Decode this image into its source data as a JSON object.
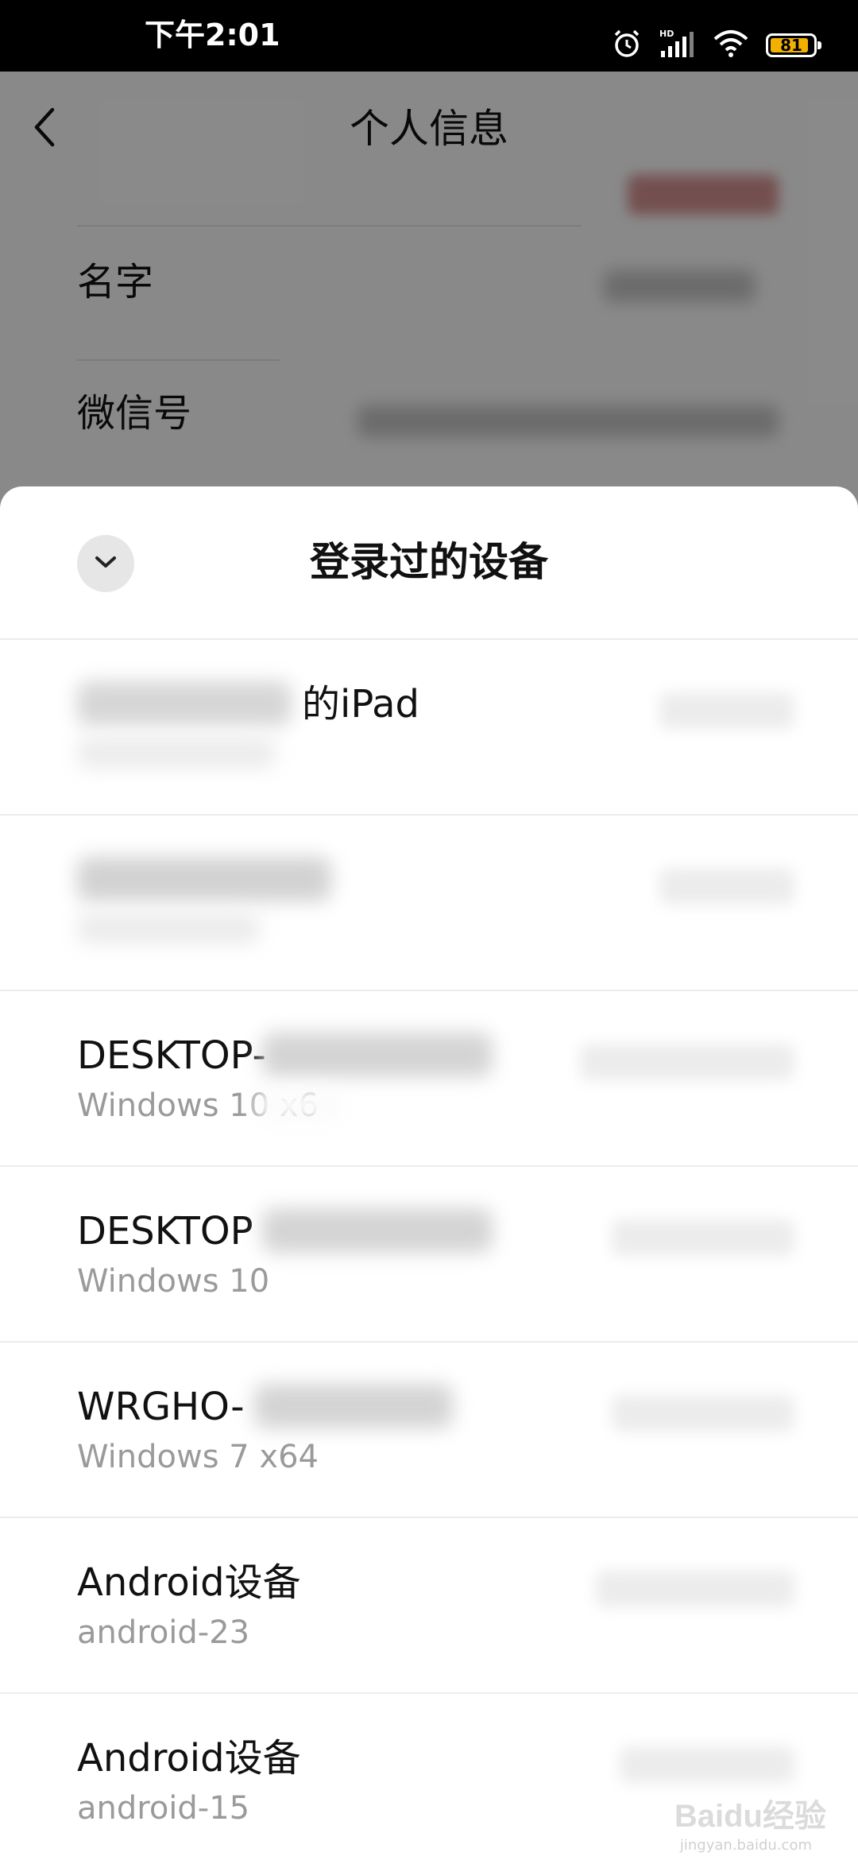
{
  "status_bar": {
    "time": "下午2:01",
    "icons": [
      "alarm-icon",
      "hd-signal-icon",
      "wifi-icon",
      "battery-icon"
    ],
    "battery_level": "81",
    "battery_color": "#f2b100"
  },
  "background_page": {
    "title": "个人信息",
    "rows": [
      {
        "label": "名字"
      },
      {
        "label": "微信号"
      }
    ]
  },
  "sheet": {
    "title": "登录过的设备",
    "collapse_icon": "chevron-down-icon",
    "devices": [
      {
        "name": "的iPad",
        "os": ""
      },
      {
        "name": "",
        "os": ""
      },
      {
        "name": "DESKTOP-",
        "os": "Windows 10 x6"
      },
      {
        "name": "DESKTOP",
        "os": "Windows 10"
      },
      {
        "name": "WRGHO-",
        "os": "Windows 7 x64"
      },
      {
        "name": "Android设备",
        "os": "android-23"
      },
      {
        "name": "Android设备",
        "os": "android-15"
      }
    ]
  },
  "watermark": {
    "text": "Baidu经验",
    "sub": "jingyan.baidu.com"
  }
}
